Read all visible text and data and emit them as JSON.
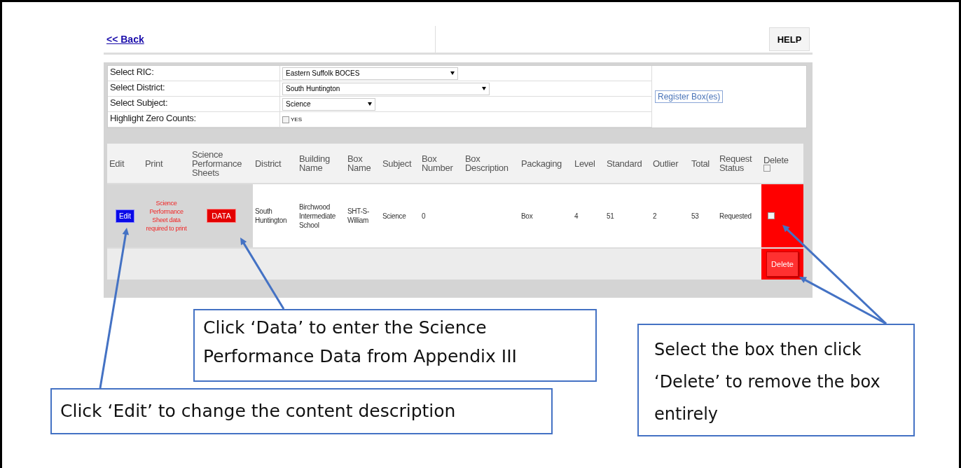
{
  "back_link": "<< Back",
  "help_button": "HELP",
  "filters": [
    {
      "kind": "select",
      "label": "Select RIC:",
      "value": "Eastern Suffolk BOCES"
    },
    {
      "kind": "select",
      "label": "Select District:",
      "value": "South Huntington"
    },
    {
      "kind": "select",
      "label": "Select Subject:",
      "value": "Science"
    },
    {
      "kind": "checkbox",
      "label": "Highlight Zero Counts:",
      "option": "YES",
      "checked": false
    }
  ],
  "register_button": "Register Box(es)",
  "table": {
    "columns": [
      "Edit",
      "Print",
      "Science Performance Sheets",
      "District",
      "Building Name",
      "Box Name",
      "Subject",
      "Box Number",
      "Box Description",
      "Packaging",
      "Level",
      "Standard",
      "Outlier",
      "Total",
      "Request Status",
      "Delete"
    ],
    "select_all_checked": false,
    "rows": [
      {
        "edit_button": "Edit",
        "print_note": "Science Performance Sheet data required to print",
        "data_button": "DATA",
        "district": "South Huntington",
        "building_name": "Birchwood Intermediate School",
        "box_name": "SHT-S-William",
        "subject": "Science",
        "box_number": "0",
        "packaging": "Box",
        "level_column": "4",
        "standard": "51",
        "outlier": "2",
        "total": "53",
        "request_status": "Requested",
        "delete_checked": false
      }
    ],
    "delete_button": "Delete"
  },
  "callouts": [
    {
      "text": "Click ‘Data’ to enter the Science Performance Data from Appendix III"
    },
    {
      "text": "Click ‘Edit’ to change the content description"
    },
    {
      "text": "Select the box then click ‘Delete’ to remove the box entirely"
    }
  ]
}
